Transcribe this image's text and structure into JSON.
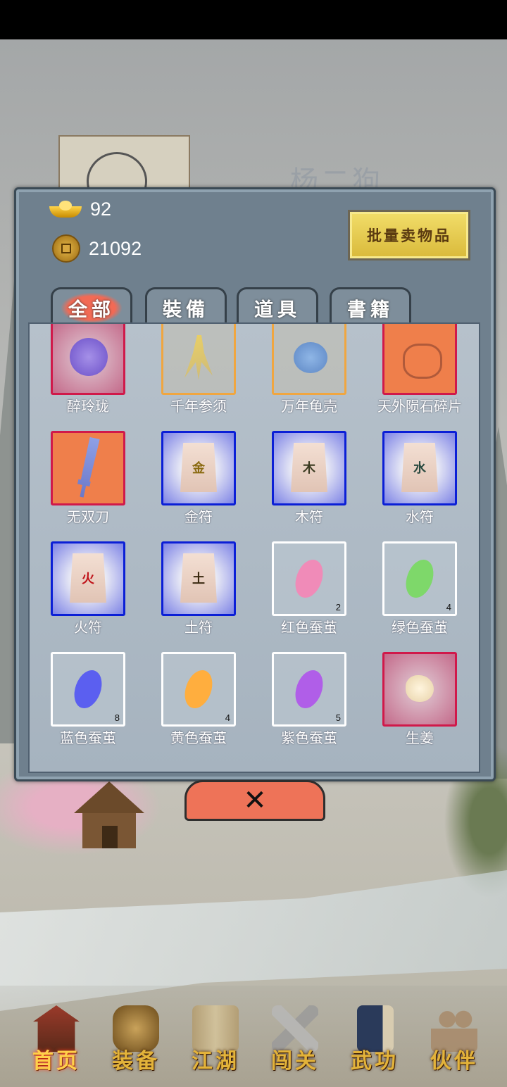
{
  "hero": {
    "name": "杨二狗"
  },
  "currency": {
    "ingots": "92",
    "coins": "21092"
  },
  "actions": {
    "bulk_sell": "批量卖物品",
    "close_symbol": "✕"
  },
  "tabs": [
    {
      "label": "全部",
      "active": true
    },
    {
      "label": "裝備",
      "active": false
    },
    {
      "label": "道具",
      "active": false
    },
    {
      "label": "書籍",
      "active": false
    }
  ],
  "items": [
    {
      "name": "醉玲珑",
      "count": "",
      "rarity": "red",
      "icon": "purple-disc-icon"
    },
    {
      "name": "千年参须",
      "count": "",
      "rarity": "gold",
      "icon": "ginseng-root-icon"
    },
    {
      "name": "万年龟壳",
      "count": "",
      "rarity": "gold",
      "icon": "turtle-shell-icon"
    },
    {
      "name": "天外陨石碎片",
      "count": "",
      "rarity": "red",
      "icon": "meteorite-shard-icon"
    },
    {
      "name": "无双刀",
      "count": "",
      "rarity": "red",
      "icon": "sword-icon"
    },
    {
      "name": "金符",
      "count": "",
      "rarity": "blue",
      "icon": "talisman-icon",
      "glyph": "金"
    },
    {
      "name": "木符",
      "count": "",
      "rarity": "blue",
      "icon": "talisman-icon",
      "glyph": "木"
    },
    {
      "name": "水符",
      "count": "",
      "rarity": "blue",
      "icon": "talisman-icon",
      "glyph": "水"
    },
    {
      "name": "火符",
      "count": "",
      "rarity": "blue",
      "icon": "talisman-icon",
      "glyph": "火"
    },
    {
      "name": "土符",
      "count": "",
      "rarity": "blue",
      "icon": "talisman-icon",
      "glyph": "土"
    },
    {
      "name": "红色蚕茧",
      "count": "2",
      "rarity": "white",
      "icon": "cocoon-icon",
      "color": "#f08bb8"
    },
    {
      "name": "绿色蚕茧",
      "count": "4",
      "rarity": "white",
      "icon": "cocoon-icon",
      "color": "#7ed86a"
    },
    {
      "name": "蓝色蚕茧",
      "count": "8",
      "rarity": "white",
      "icon": "cocoon-icon",
      "color": "#5b5ff0"
    },
    {
      "name": "黄色蚕茧",
      "count": "4",
      "rarity": "white",
      "icon": "cocoon-icon",
      "color": "#ffae3e"
    },
    {
      "name": "紫色蚕茧",
      "count": "5",
      "rarity": "white",
      "icon": "cocoon-icon",
      "color": "#b05ee8"
    },
    {
      "name": "生姜",
      "count": "",
      "rarity": "red",
      "icon": "ginger-icon"
    }
  ],
  "nav": [
    {
      "label": "首页",
      "icon": "house-icon",
      "active": true
    },
    {
      "label": "装备",
      "icon": "armor-icon",
      "active": false
    },
    {
      "label": "江湖",
      "icon": "scroll-map-icon",
      "active": false
    },
    {
      "label": "闯关",
      "icon": "crossed-swords-icon",
      "active": false
    },
    {
      "label": "武功",
      "icon": "manual-book-icon",
      "active": false
    },
    {
      "label": "伙伴",
      "icon": "partners-icon",
      "active": false
    }
  ]
}
